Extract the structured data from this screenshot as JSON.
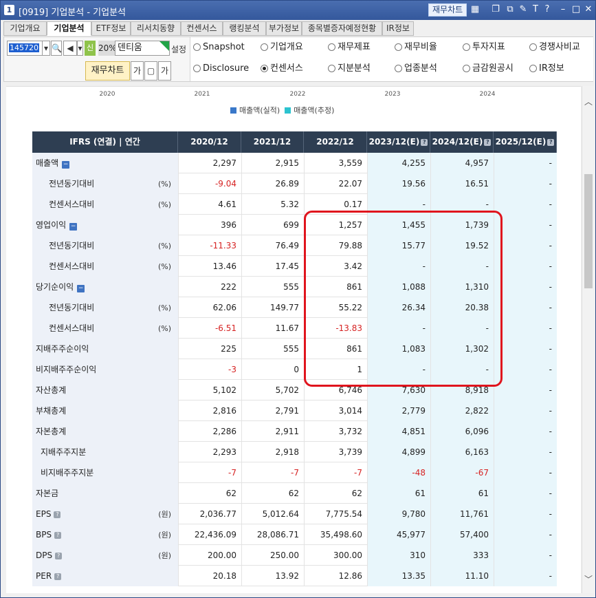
{
  "window": {
    "number": "1",
    "title": "[0919]  기업분석 - 기업분석",
    "chart_button": "재무차트",
    "icons": [
      "chart-icon",
      "restore-icon",
      "copy-icon",
      "pin-icon",
      "font-icon",
      "help-icon",
      "minimize-icon",
      "maximize-icon",
      "close-icon"
    ]
  },
  "tabs": [
    "기업개요",
    "기업분석",
    "ETF정보",
    "리서치동향",
    "컨센서스",
    "랭킹분석",
    "부가정보",
    "종목별증자예정현황",
    "IR정보"
  ],
  "active_tab": "기업분석",
  "toolbar": {
    "code": "145720",
    "sin": "신",
    "pct": "20%",
    "stock_name": "덴티움",
    "settings": "설정",
    "chart_button": "재무차트",
    "small_btn1": "가",
    "small_btn2": "▢",
    "small_btn3": "가"
  },
  "options": [
    {
      "label": "Snapshot",
      "selected": false
    },
    {
      "label": "기업개요",
      "selected": false
    },
    {
      "label": "재무제표",
      "selected": false
    },
    {
      "label": "재무비율",
      "selected": false
    },
    {
      "label": "투자지표",
      "selected": false
    },
    {
      "label": "경쟁사비교",
      "selected": false
    },
    {
      "label": "Disclosure",
      "selected": false
    },
    {
      "label": "컨센서스",
      "selected": true
    },
    {
      "label": "지분분석",
      "selected": false
    },
    {
      "label": "업종분석",
      "selected": false
    },
    {
      "label": "금감원공시",
      "selected": false
    },
    {
      "label": "IR정보",
      "selected": false
    }
  ],
  "chart_axis": [
    "2020",
    "2021",
    "2022",
    "2023",
    "2024"
  ],
  "legend": {
    "actual": "매출액(실적)",
    "estimate": "매출액(추정)",
    "actual_color": "#3a78c9",
    "estimate_color": "#2cc3cf"
  },
  "table": {
    "header_label": "IFRS (연결) | 연간",
    "columns": [
      "2020/12",
      "2021/12",
      "2022/12",
      "2023/12(E)",
      "2024/12(E)",
      "2025/12(E)"
    ],
    "estimate_columns": [
      3,
      4,
      5
    ],
    "rows": [
      {
        "label": "매출액",
        "unit": "",
        "collapsible": true,
        "info": false,
        "values": [
          "2,297",
          "2,915",
          "3,559",
          "4,255",
          "4,957",
          "-"
        ]
      },
      {
        "label": "전년동기대비",
        "unit": "(%)",
        "indent": 2,
        "values": [
          "-9.04",
          "26.89",
          "22.07",
          "19.56",
          "16.51",
          "-"
        ]
      },
      {
        "label": "컨센서스대비",
        "unit": "(%)",
        "indent": 2,
        "values": [
          "4.61",
          "5.32",
          "0.17",
          "-",
          "-",
          "-"
        ]
      },
      {
        "label": "영업이익",
        "unit": "",
        "collapsible": true,
        "values": [
          "396",
          "699",
          "1,257",
          "1,455",
          "1,739",
          "-"
        ]
      },
      {
        "label": "전년동기대비",
        "unit": "(%)",
        "indent": 2,
        "values": [
          "-11.33",
          "76.49",
          "79.88",
          "15.77",
          "19.52",
          "-"
        ]
      },
      {
        "label": "컨센서스대비",
        "unit": "(%)",
        "indent": 2,
        "values": [
          "13.46",
          "17.45",
          "3.42",
          "-",
          "-",
          "-"
        ]
      },
      {
        "label": "당기순이익",
        "unit": "",
        "collapsible": true,
        "values": [
          "222",
          "555",
          "861",
          "1,088",
          "1,310",
          "-"
        ]
      },
      {
        "label": "전년동기대비",
        "unit": "(%)",
        "indent": 2,
        "values": [
          "62.06",
          "149.77",
          "55.22",
          "26.34",
          "20.38",
          "-"
        ]
      },
      {
        "label": "컨센서스대비",
        "unit": "(%)",
        "indent": 2,
        "values": [
          "-6.51",
          "11.67",
          "-13.83",
          "-",
          "-",
          "-"
        ]
      },
      {
        "label": "지배주주순이익",
        "unit": "",
        "values": [
          "225",
          "555",
          "861",
          "1,083",
          "1,302",
          "-"
        ]
      },
      {
        "label": "비지배주주순이익",
        "unit": "",
        "values": [
          "-3",
          "0",
          "1",
          "-",
          "-",
          "-"
        ]
      },
      {
        "label": "자산총계",
        "unit": "",
        "values": [
          "5,102",
          "5,702",
          "6,746",
          "7,630",
          "8,918",
          "-"
        ]
      },
      {
        "label": "부채총계",
        "unit": "",
        "values": [
          "2,816",
          "2,791",
          "3,014",
          "2,779",
          "2,822",
          "-"
        ]
      },
      {
        "label": "자본총계",
        "unit": "",
        "values": [
          "2,286",
          "2,911",
          "3,732",
          "4,851",
          "6,096",
          "-"
        ]
      },
      {
        "label": "지배주주지분",
        "unit": "",
        "indent": 1,
        "values": [
          "2,293",
          "2,918",
          "3,739",
          "4,899",
          "6,163",
          "-"
        ]
      },
      {
        "label": "비지배주주지분",
        "unit": "",
        "indent": 1,
        "values": [
          "-7",
          "-7",
          "-7",
          "-48",
          "-67",
          "-"
        ]
      },
      {
        "label": "자본금",
        "unit": "",
        "values": [
          "62",
          "62",
          "62",
          "61",
          "61",
          "-"
        ]
      },
      {
        "label": "EPS",
        "unit": "(원)",
        "info": true,
        "values": [
          "2,036.77",
          "5,012.64",
          "7,775.54",
          "9,780",
          "11,761",
          "-"
        ]
      },
      {
        "label": "BPS",
        "unit": "(원)",
        "info": true,
        "values": [
          "22,436.09",
          "28,086.71",
          "35,498.60",
          "45,977",
          "57,400",
          "-"
        ]
      },
      {
        "label": "DPS",
        "unit": "(원)",
        "info": true,
        "values": [
          "200.00",
          "250.00",
          "300.00",
          "310",
          "333",
          "-"
        ]
      },
      {
        "label": "PER",
        "unit": "",
        "info": true,
        "values": [
          "20.18",
          "13.92",
          "12.86",
          "13.35",
          "11.10",
          "-"
        ]
      }
    ]
  },
  "colors": {
    "header_bg": "#2e3e52",
    "estimate_bg": "#e8f6fb",
    "negative": "#d62222",
    "highlight_box": "#e0141d"
  }
}
